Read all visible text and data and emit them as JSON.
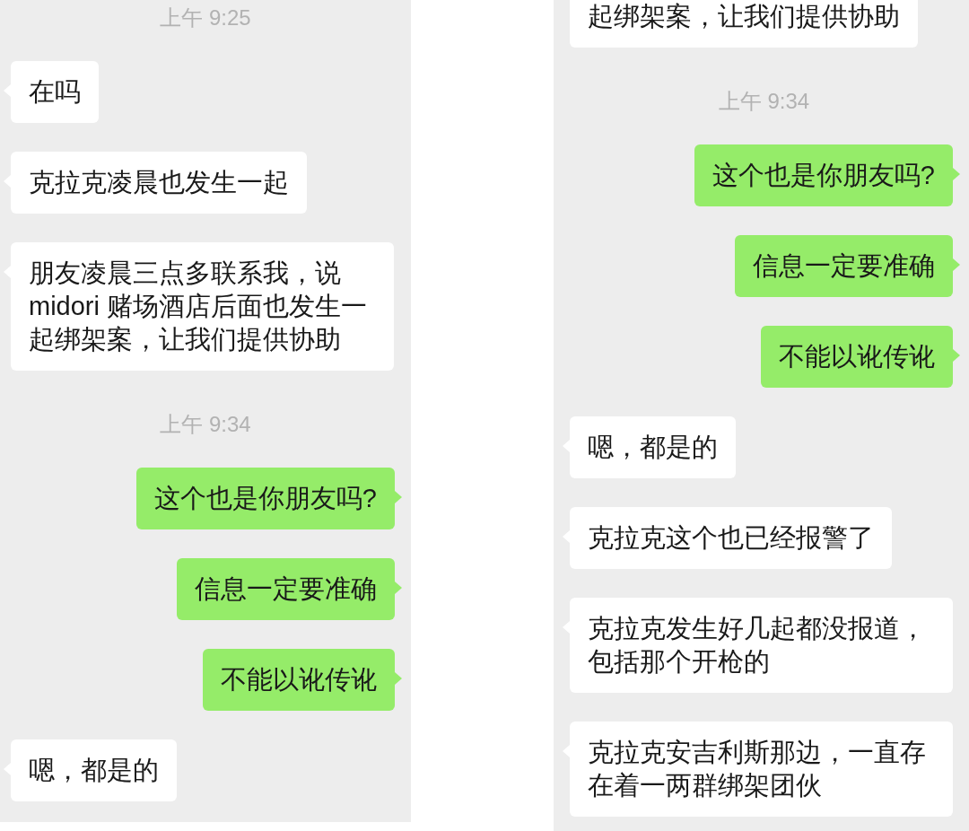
{
  "panels": [
    {
      "messages": [
        {
          "kind": "time",
          "text": "上午 9:25"
        },
        {
          "kind": "in",
          "text": "在吗"
        },
        {
          "kind": "in",
          "text": "克拉克凌晨也发生一起"
        },
        {
          "kind": "in",
          "text": "朋友凌晨三点多联系我，说midori 赌场酒店后面也发生一起绑架案，让我们提供协助"
        },
        {
          "kind": "time",
          "text": "上午 9:34"
        },
        {
          "kind": "out",
          "text": "这个也是你朋友吗?"
        },
        {
          "kind": "out",
          "text": "信息一定要准确"
        },
        {
          "kind": "out",
          "text": "不能以讹传讹"
        },
        {
          "kind": "in",
          "text": "嗯，都是的"
        }
      ]
    },
    {
      "messages": [
        {
          "kind": "in",
          "cut": true,
          "text": "起绑架案，让我们提供协助"
        },
        {
          "kind": "time",
          "text": "上午 9:34"
        },
        {
          "kind": "out",
          "text": "这个也是你朋友吗?"
        },
        {
          "kind": "out",
          "text": "信息一定要准确"
        },
        {
          "kind": "out",
          "text": "不能以讹传讹"
        },
        {
          "kind": "in",
          "text": "嗯，都是的"
        },
        {
          "kind": "in",
          "text": "克拉克这个也已经报警了"
        },
        {
          "kind": "in",
          "text": "克拉克发生好几起都没报道，包括那个开枪的"
        },
        {
          "kind": "in",
          "text": "克拉克安吉利斯那边，一直存在着一两群绑架团伙"
        }
      ]
    }
  ]
}
